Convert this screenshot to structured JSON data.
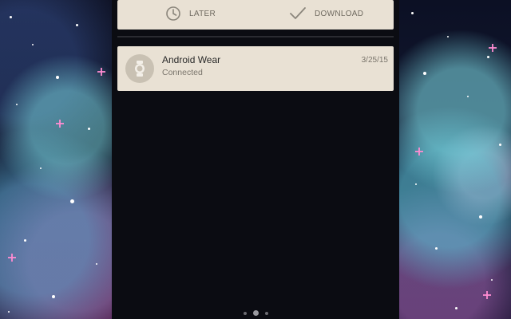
{
  "top_card": {
    "later_label": "LATER",
    "download_label": "DOWNLOAD",
    "later_icon": "clock-icon",
    "download_icon": "checkmark-icon"
  },
  "notification": {
    "title": "Android Wear",
    "subtitle": "Connected",
    "date": "3/25/15",
    "icon": "watch-icon"
  },
  "page_indicator": {
    "pages": 3,
    "active_index": 1
  },
  "colors": {
    "card_bg": "#e9e1d4",
    "panel_bg": "#0b0c12",
    "text_secondary": "#7a756c"
  }
}
